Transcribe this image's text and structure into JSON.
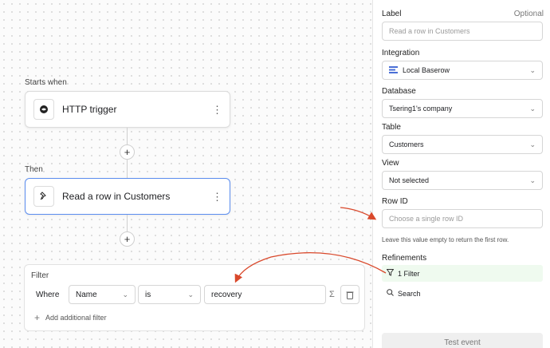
{
  "workflow": {
    "starts_when_label": "Starts when",
    "then_label": "Then",
    "trigger_node": {
      "title": "HTTP trigger",
      "icon": "globe-icon"
    },
    "action_node": {
      "title": "Read a row in Customers",
      "icon": "pin-icon"
    },
    "menu_glyph": "⋮",
    "add_glyph": "+"
  },
  "filter": {
    "title": "Filter",
    "where_label": "Where",
    "field": "Name",
    "operator": "is",
    "value": "recovery",
    "sigma": "Σ",
    "add_label": "Add additional filter",
    "add_glyph": "+"
  },
  "sidebar": {
    "label_field": {
      "label": "Label",
      "optional": "Optional",
      "placeholder": "Read a row in Customers"
    },
    "integration": {
      "label": "Integration",
      "value": "Local Baserow"
    },
    "database": {
      "label": "Database",
      "value": "Tsering1's company"
    },
    "table": {
      "label": "Table",
      "value": "Customers"
    },
    "view": {
      "label": "View",
      "value": "Not selected"
    },
    "row_id": {
      "label": "Row ID",
      "placeholder": "Choose a single row ID",
      "help": "Leave this value empty to return the first row."
    },
    "refinements": {
      "label": "Refinements",
      "filter_label": "1 Filter",
      "search_label": "Search"
    },
    "test_button": "Test event"
  },
  "colors": {
    "accent": "#5b8def",
    "annotation_arrow": "#d9482b",
    "active_filter_bg": "#effaef"
  }
}
